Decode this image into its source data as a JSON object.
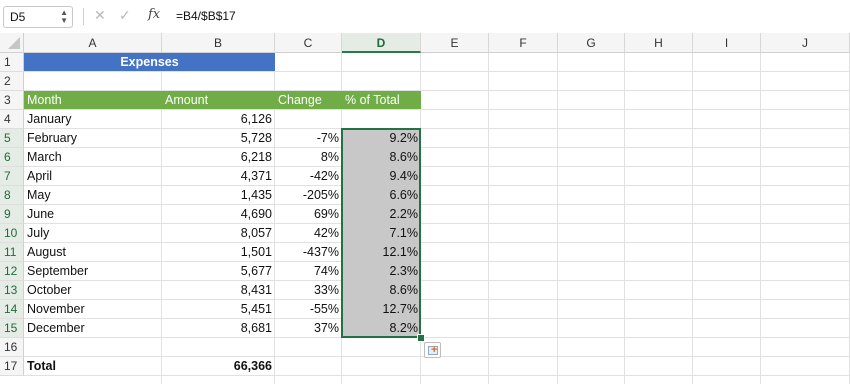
{
  "formula_bar": {
    "name_box": "D5",
    "cancel_glyph": "✕",
    "enter_glyph": "✓",
    "fx_label": "fx",
    "formula": "=B4/$B$17"
  },
  "columns": [
    "A",
    "B",
    "C",
    "D",
    "E",
    "F",
    "G",
    "H",
    "I",
    "J"
  ],
  "active_column": "D",
  "rows": [
    "1",
    "2",
    "3",
    "4",
    "5",
    "6",
    "7",
    "8",
    "9",
    "10",
    "11",
    "12",
    "13",
    "14",
    "15",
    "16",
    "17"
  ],
  "title": {
    "cell": "A1:B1",
    "text": "Expenses",
    "fill": "#4472c4"
  },
  "table_header": {
    "fill": "#70ad47",
    "month": "Month",
    "amount": "Amount",
    "change": "Change",
    "pct": "% of Total"
  },
  "data_rows": [
    {
      "month": "January",
      "amount": "6,126",
      "change": "",
      "pct": ""
    },
    {
      "month": "February",
      "amount": "5,728",
      "change": "-7%",
      "pct": "9.2%"
    },
    {
      "month": "March",
      "amount": "6,218",
      "change": "8%",
      "pct": "8.6%"
    },
    {
      "month": "April",
      "amount": "4,371",
      "change": "-42%",
      "pct": "9.4%"
    },
    {
      "month": "May",
      "amount": "1,435",
      "change": "-205%",
      "pct": "6.6%"
    },
    {
      "month": "June",
      "amount": "4,690",
      "change": "69%",
      "pct": "2.2%"
    },
    {
      "month": "July",
      "amount": "8,057",
      "change": "42%",
      "pct": "7.1%"
    },
    {
      "month": "August",
      "amount": "1,501",
      "change": "-437%",
      "pct": "12.1%"
    },
    {
      "month": "September",
      "amount": "5,677",
      "change": "74%",
      "pct": "2.3%"
    },
    {
      "month": "October",
      "amount": "8,431",
      "change": "33%",
      "pct": "8.6%"
    },
    {
      "month": "November",
      "amount": "5,451",
      "change": "-55%",
      "pct": "12.7%"
    },
    {
      "month": "December",
      "amount": "8,681",
      "change": "37%",
      "pct": "8.2%"
    }
  ],
  "total": {
    "label": "Total",
    "amount": "66,366"
  },
  "selection": {
    "range": "D5:D15",
    "border_color": "#217346"
  },
  "icons": {
    "quick_analysis": "quick-analysis-icon",
    "spin": "spinner-arrows-icon"
  }
}
